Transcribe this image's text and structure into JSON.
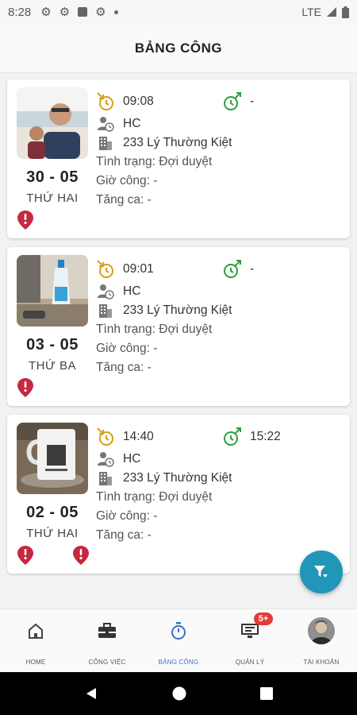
{
  "status_bar": {
    "time": "8:28",
    "network": "LTE"
  },
  "header": {
    "title": "BẢNG CÔNG"
  },
  "records": [
    {
      "date": "30 - 05",
      "weekday": "THỨ HAI",
      "check_in": "09:08",
      "check_out": "-",
      "shift": "HC",
      "location": "233 Lý Thường Kiệt",
      "status": "Tình trạng: Đợi duyệt",
      "work_hours": "Giờ công: -",
      "overtime": "Tăng ca: -",
      "warning_pins": 1
    },
    {
      "date": "03 - 05",
      "weekday": "THỨ BA",
      "check_in": "09:01",
      "check_out": "-",
      "shift": "HC",
      "location": "233 Lý Thường Kiệt",
      "status": "Tình trạng: Đợi duyệt",
      "work_hours": "Giờ công: -",
      "overtime": "Tăng ca: -",
      "warning_pins": 1
    },
    {
      "date": "02 - 05",
      "weekday": "THỨ HAI",
      "check_in": "14:40",
      "check_out": "15:22",
      "shift": "HC",
      "location": "233 Lý Thường Kiệt",
      "status": "Tình trạng: Đợi duyệt",
      "work_hours": "Giờ công: -",
      "overtime": "Tăng ca: -",
      "warning_pins": 2
    }
  ],
  "bottom_nav": {
    "items": [
      {
        "label": "HOME",
        "icon": "home-icon"
      },
      {
        "label": "CÔNG VIỆC",
        "icon": "briefcase-icon"
      },
      {
        "label": "BẢNG CÔNG",
        "icon": "stopwatch-icon",
        "active": true
      },
      {
        "label": "QUẢN LÝ",
        "icon": "monitor-icon",
        "badge": "5+"
      },
      {
        "label": "TÀI KHOẢN",
        "icon": "avatar"
      }
    ]
  },
  "colors": {
    "checkin_icon": "#d4a017",
    "checkout_icon": "#2e9e3e",
    "warning_pin": "#c62840",
    "fab": "#2196b8",
    "active_nav": "#3b6fc9",
    "badge": "#e53935"
  }
}
